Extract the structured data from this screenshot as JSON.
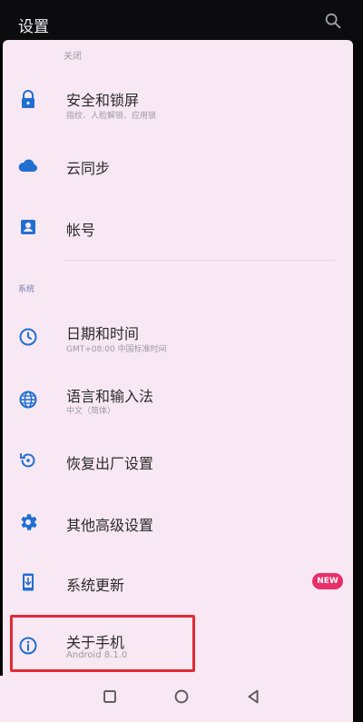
{
  "header": {
    "title": "设置",
    "search_icon": "search-icon"
  },
  "prev_item": {
    "sub": "关闭"
  },
  "items": [
    {
      "label": "安全和锁屏",
      "sub": "指纹、人脸解锁、应用锁",
      "icon": "lock-icon"
    },
    {
      "label": "云同步",
      "sub": "",
      "icon": "cloud-icon"
    },
    {
      "label": "帐号",
      "sub": "",
      "icon": "account-icon"
    }
  ],
  "section": {
    "label": "系统"
  },
  "system_items": [
    {
      "label": "日期和时间",
      "sub": "GMT+08:00 中国标准时间",
      "icon": "clock-icon"
    },
    {
      "label": "语言和输入法",
      "sub": "中文（简体）",
      "icon": "globe-icon"
    },
    {
      "label": "恢复出厂设置",
      "sub": "",
      "icon": "restore-icon"
    },
    {
      "label": "其他高级设置",
      "sub": "",
      "icon": "gear-icon"
    },
    {
      "label": "系统更新",
      "sub": "",
      "icon": "system-update-icon",
      "badge": "NEW"
    },
    {
      "label": "关于手机",
      "sub": "Android 8.1.0",
      "icon": "info-icon"
    }
  ],
  "colors": {
    "accent": "#1f6fd1",
    "badge": "#e73069",
    "highlight": "#e22b35",
    "panel": "#f8e8f3"
  }
}
